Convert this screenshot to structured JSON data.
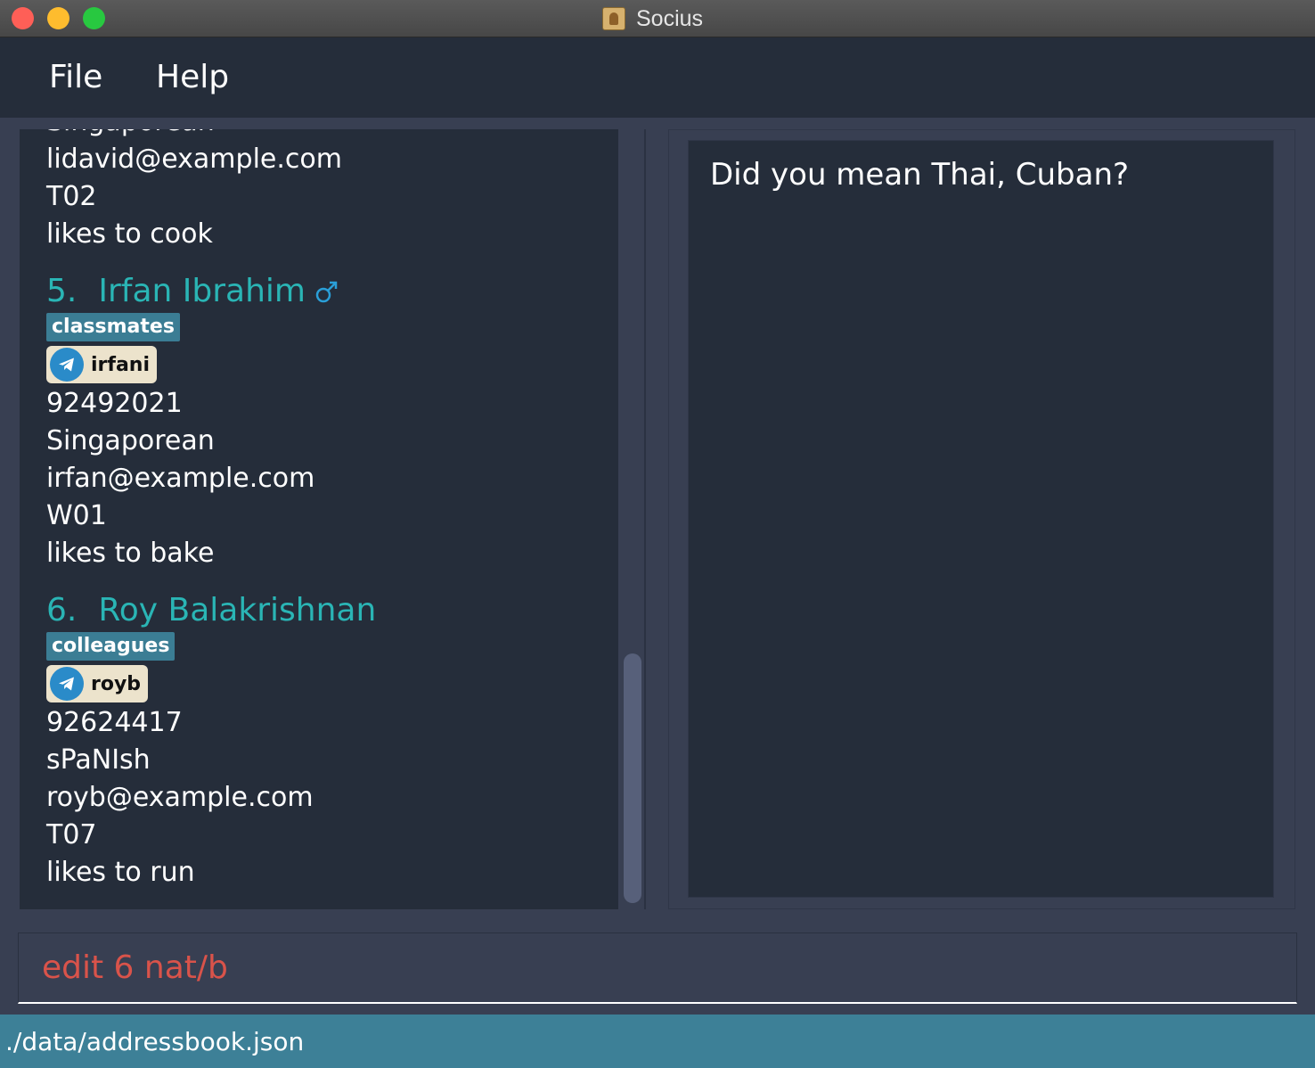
{
  "window": {
    "title": "Socius"
  },
  "menu": {
    "file": "File",
    "help": "Help"
  },
  "persons": [
    {
      "partial": true,
      "nationality": "Singaporean",
      "email": "lidavid@example.com",
      "tutorial": "T02",
      "remark": "likes to cook"
    },
    {
      "index": "5.",
      "name": "Irfan Ibrahim",
      "gender_icon": "male-icon",
      "tag": "classmates",
      "telegram": "irfani",
      "phone": "92492021",
      "nationality": "Singaporean",
      "email": "irfan@example.com",
      "tutorial": "W01",
      "remark": "likes to bake"
    },
    {
      "index": "6.",
      "name": "Roy Balakrishnan",
      "tag": "colleagues",
      "telegram": "royb",
      "phone": "92624417",
      "nationality": "sPaNIsh",
      "email": "royb@example.com",
      "tutorial": "T07",
      "remark": "likes to run"
    }
  ],
  "result": {
    "message": "Did you mean Thai, Cuban?"
  },
  "command": {
    "value": "edit 6 nat/b"
  },
  "status": {
    "path": "./data/addressbook.json"
  },
  "colors": {
    "name": "#2ab5b5",
    "tag": "#3b7d94",
    "command_text": "#d9534a",
    "status_bar": "#3d8097",
    "panel": "#252d3a"
  }
}
